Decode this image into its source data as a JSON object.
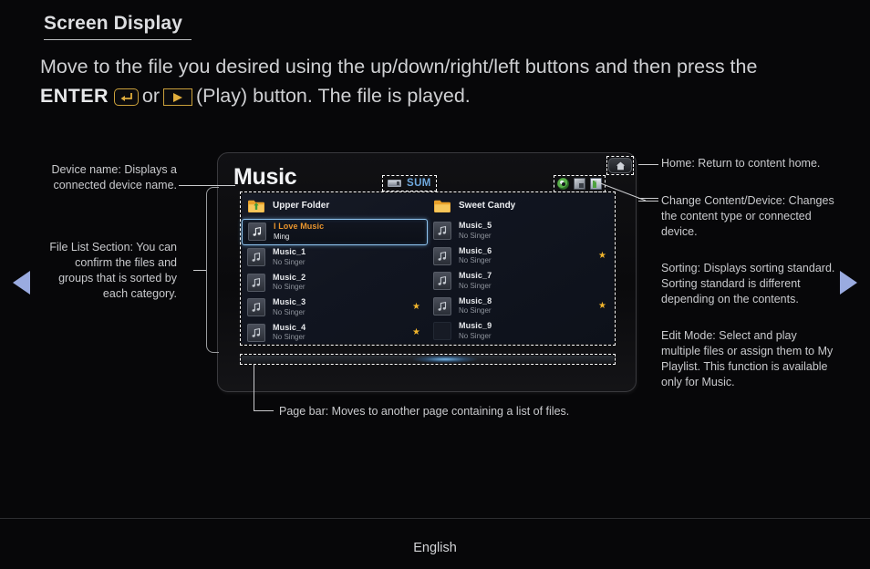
{
  "header": {
    "title": "Screen Display",
    "intro_line1": "Move to the file you desired using the up/down/right/left buttons and then press the",
    "intro_enter": "ENTER",
    "intro_or": "or",
    "intro_tail": "(Play) button. The file is played."
  },
  "nav": {
    "prev_label": "prev-page-arrow",
    "next_label": "next-page-arrow"
  },
  "tv": {
    "title": "Music",
    "device_badge": "SUM",
    "home_button": "home",
    "tool_icons": [
      "content-disc-icon",
      "change-device-icon",
      "sorting-icon"
    ],
    "columns": [
      {
        "folder": "Upper Folder",
        "items": [
          {
            "title": "I Love Music",
            "subtitle": "Ming",
            "selected": true,
            "starred": false
          },
          {
            "title": "Music_1",
            "subtitle": "No Singer",
            "selected": false,
            "starred": false
          },
          {
            "title": "Music_2",
            "subtitle": "No Singer",
            "selected": false,
            "starred": false
          },
          {
            "title": "Music_3",
            "subtitle": "No Singer",
            "selected": false,
            "starred": true
          },
          {
            "title": "Music_4",
            "subtitle": "No Singer",
            "selected": false,
            "starred": true
          }
        ]
      },
      {
        "folder": "Sweet Candy",
        "items": [
          {
            "title": "Music_5",
            "subtitle": "No Singer",
            "selected": false,
            "starred": false
          },
          {
            "title": "Music_6",
            "subtitle": "No Singer",
            "selected": false,
            "starred": true
          },
          {
            "title": "Music_7",
            "subtitle": "No Singer",
            "selected": false,
            "starred": false
          },
          {
            "title": "Music_8",
            "subtitle": "No Singer",
            "selected": false,
            "starred": true
          },
          {
            "title": "Music_9",
            "subtitle": "No Singer",
            "selected": false,
            "starred": false
          }
        ]
      }
    ]
  },
  "annotations": {
    "device_name": "Device name: Displays a connected device name.",
    "file_list": "File List Section: You can confirm the files and groups that is sorted by each category.",
    "home": "Home: Return to content home.",
    "change_content": "Change Content/Device: Changes the content type or connected device.",
    "sorting": "Sorting: Displays sorting standard. Sorting standard is different depending on the contents.",
    "edit_mode": "Edit Mode: Select and play multiple files or assign them to My Playlist. This function is available only for Music.",
    "page_bar": "Page bar: Moves to another page containing a list of files."
  },
  "footer": {
    "language": "English"
  },
  "colors": {
    "accent_gold": "#caa03b",
    "selected_title": "#e8952e",
    "selection_border": "#8fc4ef",
    "badge_blue": "#6fa8dd",
    "star_gold": "#f0b42c",
    "arrow_blue": "#9aabe0",
    "page_background": "#070709"
  }
}
